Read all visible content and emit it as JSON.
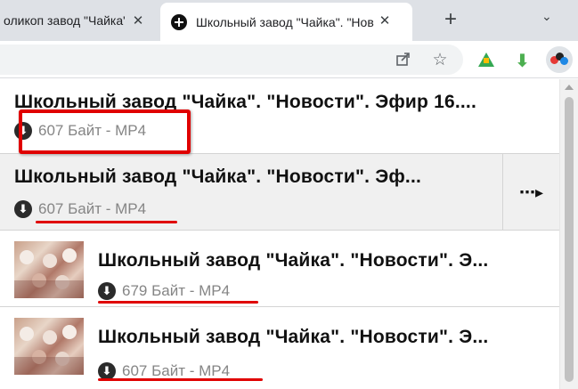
{
  "browser": {
    "tabs": [
      {
        "title": "оликоп завод \"Чайка\". \"Нов",
        "close": "✕"
      },
      {
        "title": "Школьный завод \"Чайка\". \"Нов",
        "close": "✕"
      }
    ],
    "new_tab": "+",
    "window_control": "⌄",
    "icons": {
      "favicon": "circle-favicon-icon",
      "share": "share-icon",
      "star": "bookmark-star-icon",
      "ext_drive": "google-drive-icon",
      "ext_download": "green-download-arrow-icon",
      "ext_menu": "extension-menu-icon"
    }
  },
  "downloads": {
    "items": [
      {
        "title": "Школьный завод \"Чайка\". \"Новости\". Эфир 16....",
        "size": "607 Байт - MP4",
        "thumbnail": false
      },
      {
        "title": "Школьный завод \"Чайка\". \"Новости\". Эф...",
        "size": "607 Байт - MP4",
        "thumbnail": false,
        "more": "⋯▸"
      },
      {
        "title": "Школьный завод \"Чайка\". \"Новости\". Э...",
        "size": "679 Байт - MP4",
        "thumbnail": true
      },
      {
        "title": "Школьный завод \"Чайка\". \"Новости\". Э...",
        "size": "607 Байт - MP4",
        "thumbnail": true
      }
    ],
    "download_glyph": "⬇"
  },
  "colors": {
    "highlight": "#e00000",
    "tabbar": "#dee1e6",
    "selected_row": "#f0f0f0",
    "meta_text": "#858585"
  }
}
